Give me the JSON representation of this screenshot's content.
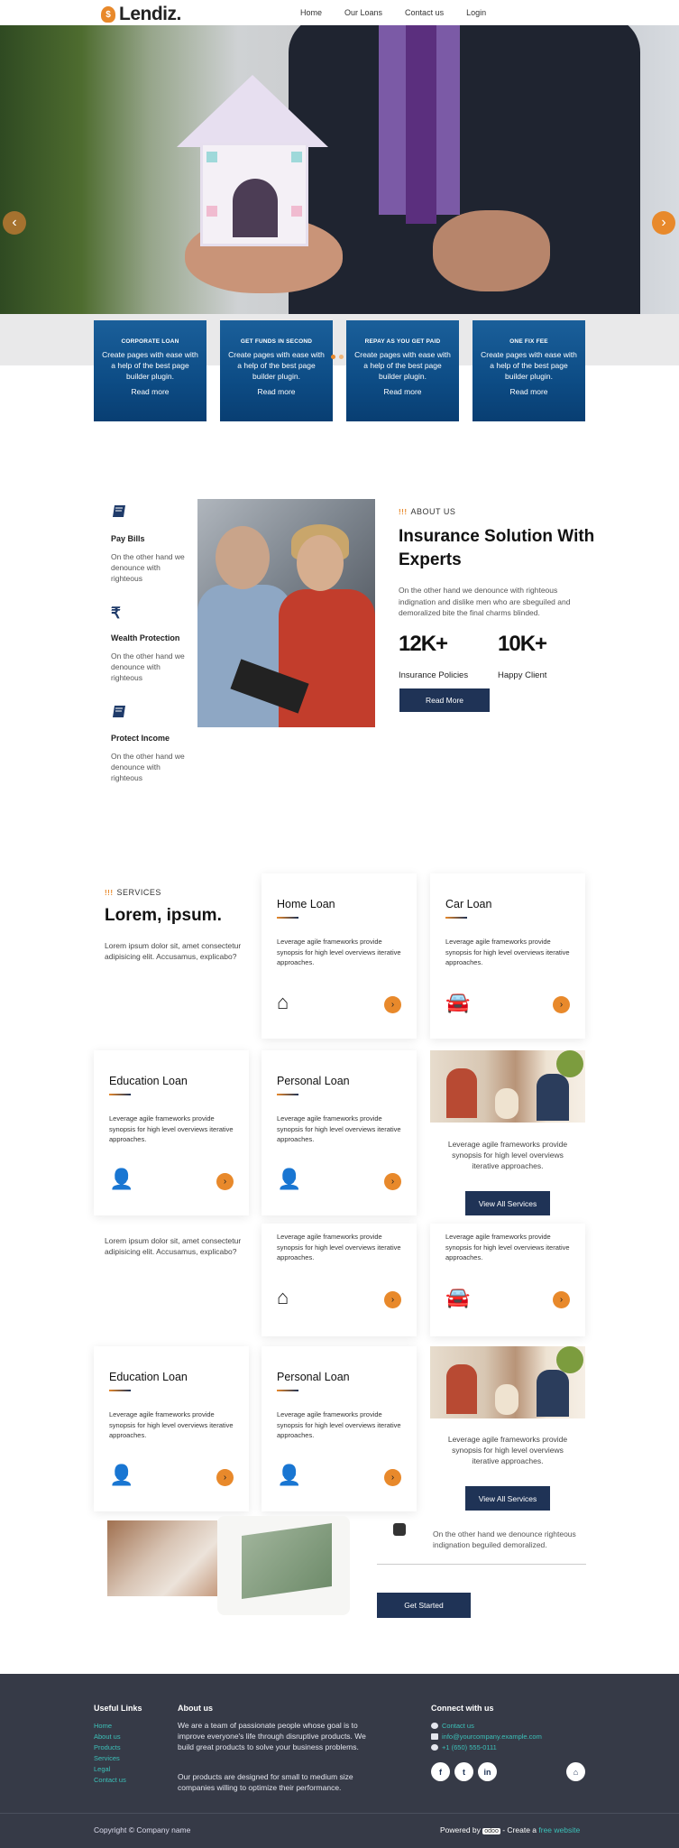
{
  "brand": {
    "name": "Lendiz.",
    "badge": "$"
  },
  "nav": {
    "items": [
      "Home",
      "Our Loans",
      "Contact us",
      "Login"
    ]
  },
  "hero": {
    "prev_icon": "chevron-left-icon",
    "next_icon": "chevron-right-icon",
    "arrow_prev": "‹",
    "arrow_next": "›"
  },
  "features": [
    {
      "title": "CORPORATE LOAN",
      "desc": "Create pages with ease with a help of the best page builder plugin.",
      "link": "Read more"
    },
    {
      "title": "GET FUNDS IN SECOND",
      "desc": "Create pages with ease with a help of the best page builder plugin.",
      "link": "Read more"
    },
    {
      "title": "REPAY AS YOU GET PAID",
      "desc": "Create pages with ease with a help of the best page builder plugin.",
      "link": "Read more"
    },
    {
      "title": "ONE FIX FEE",
      "desc": "Create pages with ease with a help of the best page builder plugin.",
      "link": "Read more"
    }
  ],
  "about_side": [
    {
      "icon": "book-icon",
      "title": "Pay Bills",
      "text": "On the other hand we denounce with righteous"
    },
    {
      "icon": "rupee-icon",
      "title": "Wealth Protection",
      "text": "On the other hand we denounce with righteous"
    },
    {
      "icon": "book-icon",
      "title": "Protect Income",
      "text": "On the other hand we denounce with righteous"
    }
  ],
  "about": {
    "tag_mark": "!!!",
    "tag": "ABOUT US",
    "title": "Insurance Solution With Experts",
    "text": "On the other hand we denounce with righteous indignation and dislike men who are sbeguiled and demoralized bite the final charms blinded.",
    "stats": [
      {
        "number": "12K+",
        "label": "Insurance Policies"
      },
      {
        "number": "10K+",
        "label": "Happy Client"
      }
    ],
    "button": "Read More"
  },
  "services": {
    "tag_mark": "!!!",
    "tag": "SERVICES",
    "title": "Lorem, ipsum.",
    "intro": "Lorem ipsum dolor sit, amet consectetur adipisicing elit. Accusamus, explicabo?",
    "card_desc": "Leverage agile frameworks provide synopsis for high level overviews iterative approaches.",
    "photo_text": "Leverage agile frameworks provide synopsis for high level overviews iterative approaches.",
    "view_all": "View All Services",
    "arrow": "›",
    "cards": {
      "home": {
        "title": "Home Loan",
        "icon": "home-icon",
        "glyph": "⌂"
      },
      "car": {
        "title": "Car Loan",
        "icon": "car-icon",
        "glyph": "🚘"
      },
      "education": {
        "title": "Education Loan",
        "icon": "user-icon",
        "glyph": "👤"
      },
      "personal": {
        "title": "Personal Loan",
        "icon": "user-icon",
        "glyph": "👤"
      }
    }
  },
  "community": {
    "text": "On the other hand we denounce righteous indignation beguiled demoralized.",
    "button": "Get Started"
  },
  "footer": {
    "useful_title": "Useful Links",
    "links": [
      "Home",
      "About us",
      "Products",
      "Services",
      "Legal",
      "Contact us"
    ],
    "about_title": "About us",
    "about_p1": "We are a team of passionate people whose goal is to improve everyone's life through disruptive products. We build great products to solve your business problems.",
    "about_p2": "Our products are designed for small to medium size companies willing to optimize their performance.",
    "connect_title": "Connect with us",
    "contacts": [
      "Contact us",
      "info@yourcompany.example.com",
      "+1 (650) 555-0111"
    ],
    "social": [
      "f",
      "t",
      "in",
      "⌂"
    ],
    "copyright": "Copyright © Company name",
    "powered": "Powered by",
    "odoo": "odoo",
    "create": "- Create a",
    "free": "free website"
  }
}
